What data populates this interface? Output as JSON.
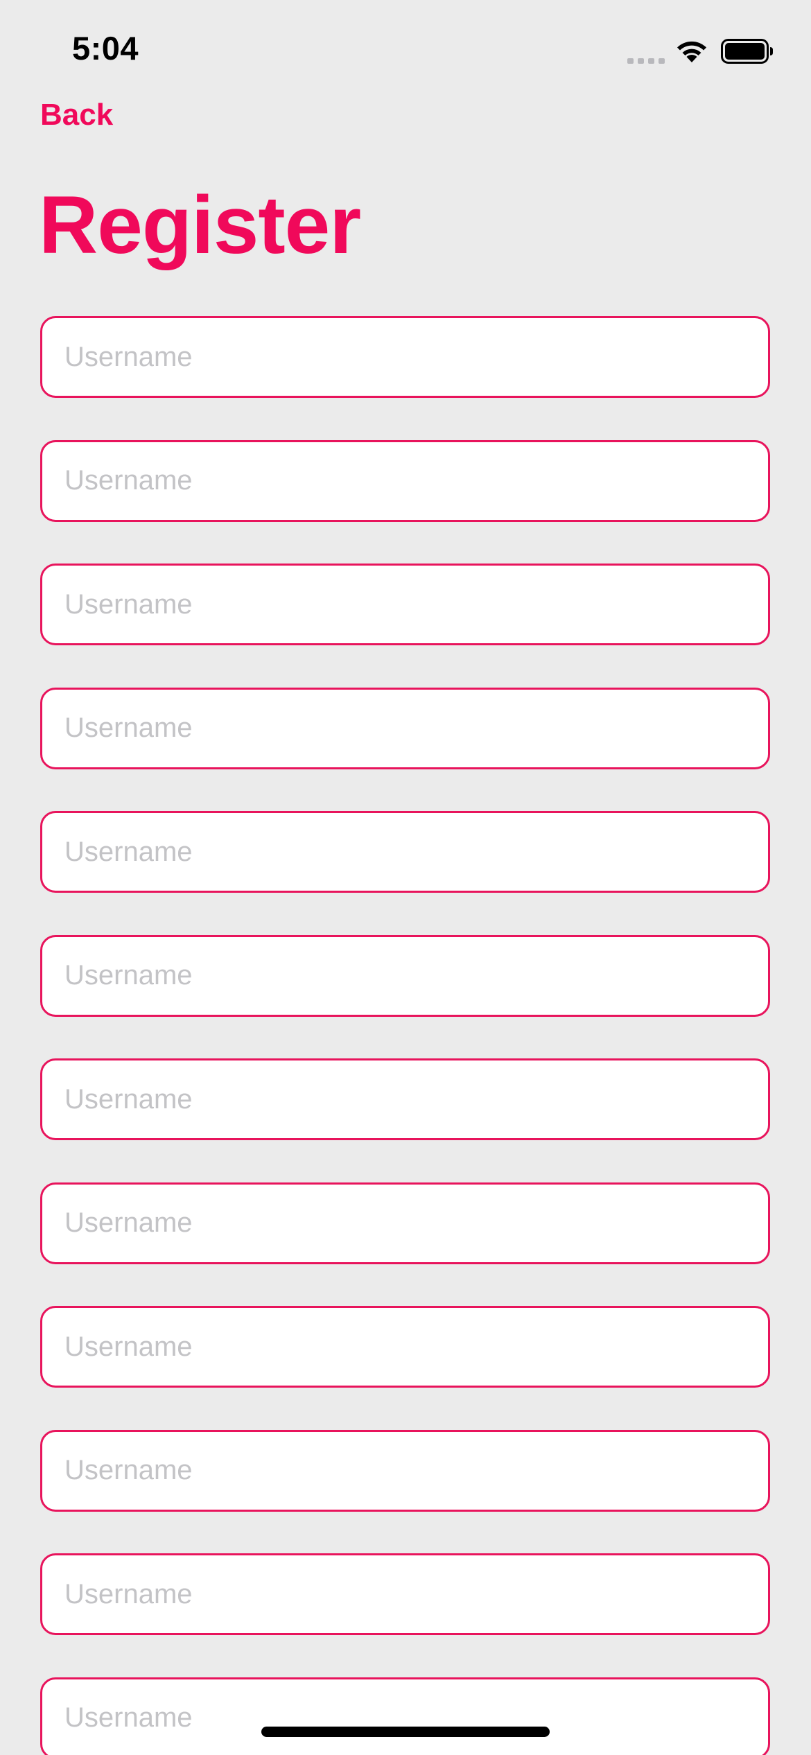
{
  "status_bar": {
    "time": "5:04",
    "icons": [
      "signal-icon",
      "wifi-icon",
      "battery-icon"
    ]
  },
  "nav": {
    "back_label": "Back"
  },
  "page": {
    "title": "Register"
  },
  "form": {
    "fields": [
      {
        "placeholder": "Username",
        "value": ""
      },
      {
        "placeholder": "Username",
        "value": ""
      },
      {
        "placeholder": "Username",
        "value": ""
      },
      {
        "placeholder": "Username",
        "value": ""
      },
      {
        "placeholder": "Username",
        "value": ""
      },
      {
        "placeholder": "Username",
        "value": ""
      },
      {
        "placeholder": "Username",
        "value": ""
      },
      {
        "placeholder": "Username",
        "value": ""
      },
      {
        "placeholder": "Username",
        "value": ""
      },
      {
        "placeholder": "Username",
        "value": ""
      },
      {
        "placeholder": "Username",
        "value": ""
      },
      {
        "placeholder": "Username",
        "value": ""
      }
    ]
  },
  "colors": {
    "accent": "#F0095A",
    "field_border": "#E8145C",
    "background": "#EBEBEB",
    "field_background": "#FFFFFF",
    "placeholder": "#C3C3C6"
  }
}
